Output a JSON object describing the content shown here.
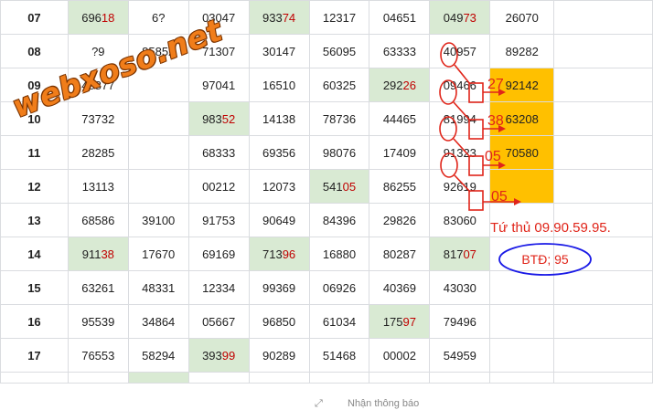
{
  "watermark": {
    "text": "webxoso.net"
  },
  "colors": {
    "highlight_cell": "#d9ead3",
    "gold_cell": "#ffc000",
    "annotation_red": "#e0251a",
    "oval_blue": "#1a1ae6",
    "watermark_orange": "#f07d1a"
  },
  "rows": [
    {
      "label": "07",
      "cells": [
        {
          "v": "69618",
          "hl": true,
          "split": 3
        },
        {
          "v": "6?",
          "hl": false
        },
        {
          "v": "03047",
          "hl": false
        },
        {
          "v": "93374",
          "hl": true,
          "split": 3
        },
        {
          "v": "12317",
          "hl": false
        },
        {
          "v": "04651",
          "hl": false
        },
        {
          "v": "04973",
          "hl": true,
          "split": 3
        },
        {
          "v": "26070",
          "hl": false
        }
      ]
    },
    {
      "label": "08",
      "cells": [
        {
          "v": "?9",
          "hl": false
        },
        {
          "v": "85852",
          "hl": false
        },
        {
          "v": "71307",
          "hl": false
        },
        {
          "v": "30147",
          "hl": false
        },
        {
          "v": "56095",
          "hl": false
        },
        {
          "v": "63333",
          "hl": false
        },
        {
          "v": "40957",
          "hl": false
        },
        {
          "v": "89282",
          "hl": false
        }
      ]
    },
    {
      "label": "09",
      "cells": [
        {
          "v": "48877",
          "hl": false
        },
        {
          "v": "",
          "hl": false
        },
        {
          "v": "97041",
          "hl": false
        },
        {
          "v": "16510",
          "hl": false
        },
        {
          "v": "60325",
          "hl": false
        },
        {
          "v": "29226",
          "hl": true,
          "split": 3
        },
        {
          "v": "09466",
          "hl": false
        },
        {
          "v": "92142",
          "hl": false,
          "gold": true
        }
      ]
    },
    {
      "label": "10",
      "cells": [
        {
          "v": "73732",
          "hl": false
        },
        {
          "v": "",
          "hl": false
        },
        {
          "v": "98352",
          "hl": true,
          "split": 3
        },
        {
          "v": "14138",
          "hl": false
        },
        {
          "v": "78736",
          "hl": false
        },
        {
          "v": "44465",
          "hl": false
        },
        {
          "v": "81994",
          "hl": false
        },
        {
          "v": "63208",
          "hl": false,
          "gold": true
        }
      ]
    },
    {
      "label": "11",
      "cells": [
        {
          "v": "28285",
          "hl": false
        },
        {
          "v": "",
          "hl": false
        },
        {
          "v": "68333",
          "hl": false
        },
        {
          "v": "69356",
          "hl": false
        },
        {
          "v": "98076",
          "hl": false
        },
        {
          "v": "17409",
          "hl": false
        },
        {
          "v": "91323",
          "hl": false
        },
        {
          "v": "70580",
          "hl": false,
          "gold": true
        }
      ]
    },
    {
      "label": "12",
      "cells": [
        {
          "v": "13113",
          "hl": false
        },
        {
          "v": "",
          "hl": false
        },
        {
          "v": "00212",
          "hl": false
        },
        {
          "v": "12073",
          "hl": false
        },
        {
          "v": "54105",
          "hl": true,
          "split": 3
        },
        {
          "v": "86255",
          "hl": false
        },
        {
          "v": "92619",
          "hl": false
        },
        {
          "v": "",
          "hl": false,
          "gold": true
        }
      ]
    },
    {
      "label": "13",
      "cells": [
        {
          "v": "68586",
          "hl": false
        },
        {
          "v": "39100",
          "hl": false
        },
        {
          "v": "91753",
          "hl": false
        },
        {
          "v": "90649",
          "hl": false
        },
        {
          "v": "84396",
          "hl": false
        },
        {
          "v": "29826",
          "hl": false
        },
        {
          "v": "83060",
          "hl": false
        },
        {
          "v": "",
          "hl": false
        }
      ]
    },
    {
      "label": "14",
      "cells": [
        {
          "v": "91138",
          "hl": true,
          "split": 3
        },
        {
          "v": "17670",
          "hl": false
        },
        {
          "v": "69169",
          "hl": false
        },
        {
          "v": "71396",
          "hl": true,
          "split": 3
        },
        {
          "v": "16880",
          "hl": false
        },
        {
          "v": "80287",
          "hl": false
        },
        {
          "v": "81707",
          "hl": true,
          "split": 3
        },
        {
          "v": "",
          "hl": false
        }
      ]
    },
    {
      "label": "15",
      "cells": [
        {
          "v": "63261",
          "hl": false
        },
        {
          "v": "48331",
          "hl": false
        },
        {
          "v": "12334",
          "hl": false
        },
        {
          "v": "99369",
          "hl": false
        },
        {
          "v": "06926",
          "hl": false
        },
        {
          "v": "40369",
          "hl": false
        },
        {
          "v": "43030",
          "hl": false
        },
        {
          "v": "",
          "hl": false
        }
      ]
    },
    {
      "label": "16",
      "cells": [
        {
          "v": "95539",
          "hl": false
        },
        {
          "v": "34864",
          "hl": false
        },
        {
          "v": "05667",
          "hl": false
        },
        {
          "v": "96850",
          "hl": false
        },
        {
          "v": "61034",
          "hl": false
        },
        {
          "v": "17597",
          "hl": true,
          "split": 3
        },
        {
          "v": "79496",
          "hl": false
        },
        {
          "v": "",
          "hl": false
        }
      ]
    },
    {
      "label": "17",
      "cells": [
        {
          "v": "76553",
          "hl": false
        },
        {
          "v": "58294",
          "hl": false
        },
        {
          "v": "39399",
          "hl": true,
          "split": 3
        },
        {
          "v": "90289",
          "hl": false
        },
        {
          "v": "51468",
          "hl": false
        },
        {
          "v": "00002",
          "hl": false
        },
        {
          "v": "54959",
          "hl": false
        },
        {
          "v": "",
          "hl": false
        }
      ]
    }
  ],
  "annotations": {
    "numbers": [
      "27",
      "38",
      "05",
      "05"
    ],
    "note": "Tứ thủ 09.90.59.95.",
    "btd": "BTĐ; 95"
  },
  "footer": {
    "text": "Nhận thông báo"
  }
}
